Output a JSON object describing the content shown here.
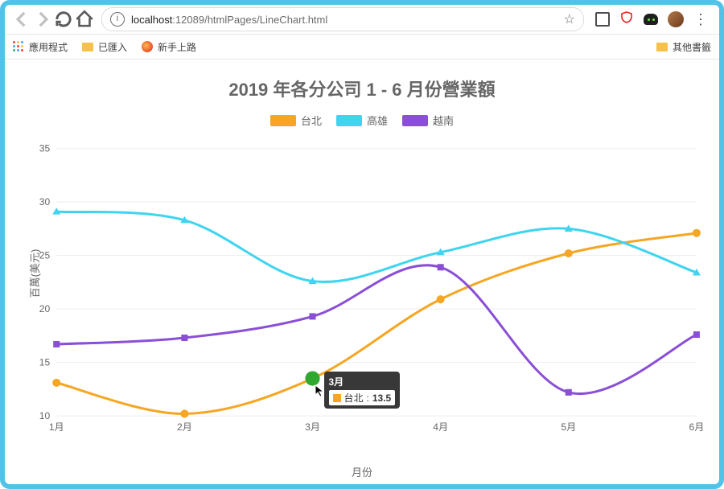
{
  "browser": {
    "url_host": "localhost",
    "url_port": ":12089",
    "url_path": "/htmlPages/LineChart.html",
    "bookmarks": {
      "apps": "應用程式",
      "imported": "已匯入",
      "newbie": "新手上路",
      "other": "其他書籤"
    }
  },
  "chart_data": {
    "type": "line",
    "title": "2019 年各分公司 1 - 6 月份營業額",
    "xlabel": "月份",
    "ylabel": "百萬(美元)",
    "categories": [
      "1月",
      "2月",
      "3月",
      "4月",
      "5月",
      "6月"
    ],
    "ylim": [
      10,
      35
    ],
    "yticks": [
      10,
      15,
      20,
      25,
      30,
      35
    ],
    "series": [
      {
        "name": "台北",
        "color": "#f5a623",
        "marker": "circle",
        "values": [
          13.1,
          10.2,
          13.5,
          20.9,
          25.2,
          27.1
        ]
      },
      {
        "name": "高雄",
        "color": "#3fd4f0",
        "marker": "triangle",
        "values": [
          29.1,
          28.3,
          22.6,
          25.3,
          27.5,
          23.4
        ]
      },
      {
        "name": "越南",
        "color": "#8a4fd6",
        "marker": "square",
        "values": [
          16.7,
          17.3,
          19.3,
          23.9,
          12.2,
          17.6
        ]
      }
    ],
    "tooltip": {
      "category": "3月",
      "series": "台北",
      "value": "13.5",
      "color": "#f5a623"
    }
  }
}
